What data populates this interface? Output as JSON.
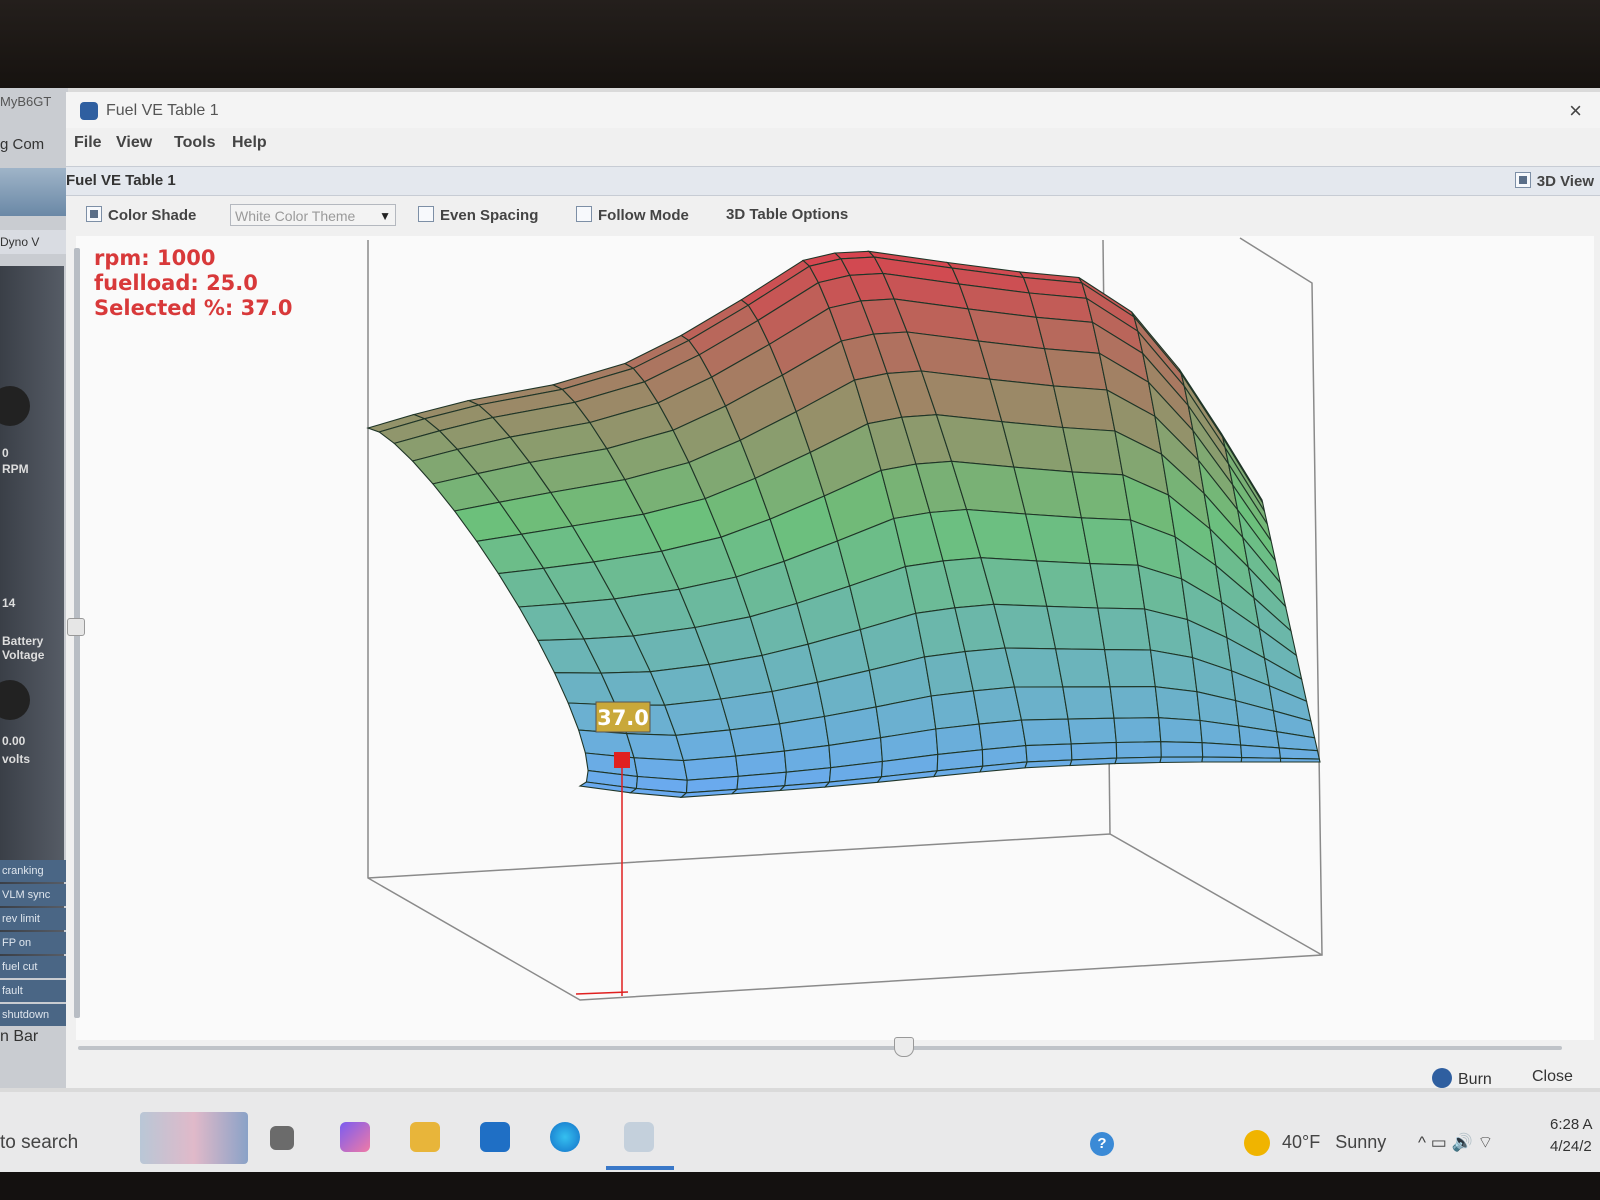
{
  "background_app": {
    "title": "MyB6GT",
    "menu": "g   Com",
    "tab": "Dyno V",
    "indicators": [
      "cranking",
      "VLM sync",
      "rev limit",
      "FP on",
      "fuel cut",
      "fault",
      "shutdown"
    ],
    "gauges": [
      {
        "label": "RPM",
        "value": "0"
      },
      {
        "label": "Battery Voltage",
        "value": "14"
      },
      {
        "label": "volts",
        "value": "0.00"
      }
    ],
    "bottom_tabs": "n   Bar"
  },
  "window": {
    "title": "Fuel VE Table 1",
    "close_label": "×",
    "menu": [
      "File",
      "View",
      "Tools",
      "Help"
    ],
    "subheader_title": "Fuel VE Table 1",
    "view3d_label": "3D View"
  },
  "toolbar": {
    "color_shade_label": "Color Shade",
    "color_shade_checked": true,
    "theme_value": "White Color Theme",
    "theme_caret": "▼",
    "even_spacing_label": "Even Spacing",
    "even_spacing_checked": false,
    "follow_mode_label": "Follow Mode",
    "follow_mode_checked": false,
    "table_options_label": "3D Table Options"
  },
  "info": {
    "rpm": "rpm: 1000",
    "fuelload": "fuelload: 25.0",
    "selected": "Selected %: 37.0"
  },
  "selected_cell": {
    "label": "37.0",
    "rpm": 1000,
    "fuelload": 25.0,
    "value": 37.0
  },
  "colors": {
    "high": "#d9414e",
    "mid": "#6cc07a",
    "low": "#6aaaf0",
    "grid": "#1f3527",
    "info_text": "#d8393a",
    "marker": "#e02020",
    "label_bg": "#c9a83a"
  },
  "footer": {
    "burn_label": "Burn",
    "close_label": "Close",
    "slider_position": 0.55
  },
  "taskbar": {
    "search": "to search",
    "weather_temp": "40°F",
    "weather_text": "Sunny",
    "time": "6:28 A",
    "date": "4/24/2",
    "tray_glyphs": "^  ▭  🔊  ⌔",
    "help_glyph": "?"
  }
}
